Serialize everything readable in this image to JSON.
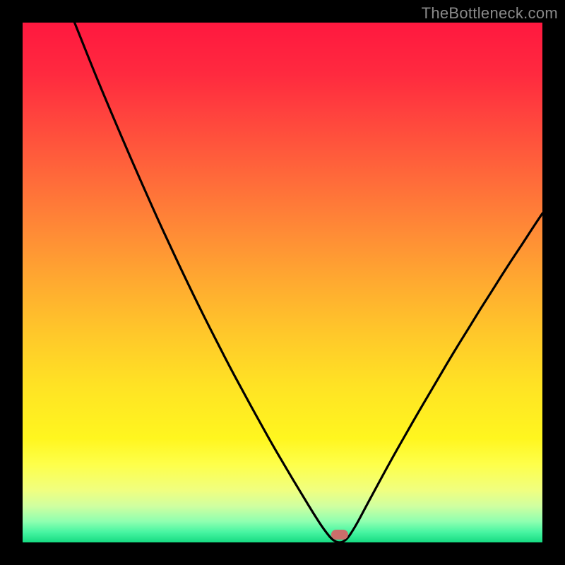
{
  "watermark": "TheBottleneck.com",
  "chart_data": {
    "type": "line",
    "title": "",
    "xlabel": "",
    "ylabel": "",
    "xlim": [
      0,
      100
    ],
    "ylim": [
      0,
      100
    ],
    "x": [
      10,
      12,
      14,
      16,
      18,
      20,
      22,
      24,
      26,
      28,
      30,
      32,
      34,
      36,
      38,
      40,
      42,
      44,
      46,
      48,
      50,
      52,
      54,
      56,
      58,
      60,
      62,
      64,
      66,
      68,
      70,
      72,
      74,
      76,
      78,
      80,
      82,
      84,
      86,
      88,
      90,
      92,
      94,
      96,
      98,
      100
    ],
    "values": [
      100.0,
      95.0,
      90.0,
      85.2,
      80.5,
      75.8,
      71.2,
      66.7,
      62.2,
      57.9,
      53.6,
      49.4,
      45.3,
      41.3,
      37.4,
      33.5,
      29.8,
      26.1,
      22.5,
      18.9,
      15.5,
      12.1,
      8.8,
      5.5,
      2.4,
      0.0,
      0.0,
      3.0,
      6.8,
      10.5,
      14.2,
      17.8,
      21.3,
      24.8,
      28.2,
      31.6,
      35.0,
      38.3,
      41.5,
      44.8,
      47.9,
      51.1,
      54.2,
      57.2,
      60.3,
      63.3
    ],
    "marker": {
      "x": 61,
      "y": 1.5
    },
    "gradient_bands": [
      {
        "stop": 0.0,
        "color": "#ff183f"
      },
      {
        "stop": 0.1,
        "color": "#ff2a3f"
      },
      {
        "stop": 0.2,
        "color": "#ff4a3d"
      },
      {
        "stop": 0.3,
        "color": "#ff6a3a"
      },
      {
        "stop": 0.4,
        "color": "#ff8a36"
      },
      {
        "stop": 0.5,
        "color": "#ffaa30"
      },
      {
        "stop": 0.6,
        "color": "#ffc82a"
      },
      {
        "stop": 0.7,
        "color": "#ffe324"
      },
      {
        "stop": 0.8,
        "color": "#fff61f"
      },
      {
        "stop": 0.85,
        "color": "#feff4a"
      },
      {
        "stop": 0.9,
        "color": "#f0ff80"
      },
      {
        "stop": 0.93,
        "color": "#d0ffa0"
      },
      {
        "stop": 0.96,
        "color": "#8effb0"
      },
      {
        "stop": 0.98,
        "color": "#48f5a2"
      },
      {
        "stop": 1.0,
        "color": "#16db82"
      }
    ]
  }
}
